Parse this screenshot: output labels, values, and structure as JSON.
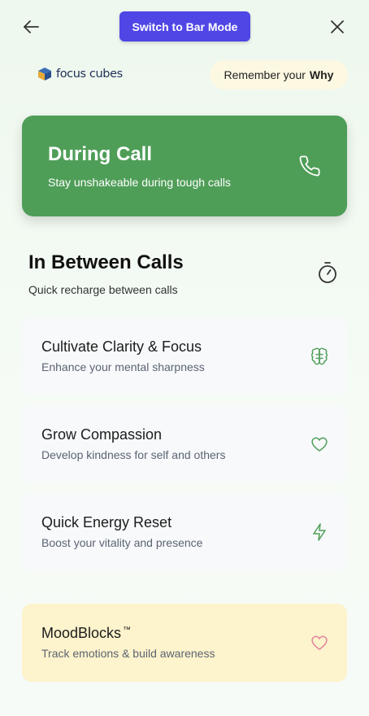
{
  "header": {
    "switch_label": "Switch to Bar Mode"
  },
  "brand": {
    "name": "focus cubes",
    "accent_colors": [
      "#3b6fb6",
      "#e6a935",
      "#2a4f8f"
    ]
  },
  "why_pill": {
    "prefix": "Remember your",
    "emphasis": "Why"
  },
  "during_call": {
    "title": "During Call",
    "subtitle": "Stay unshakeable during tough calls",
    "icon": "phone-icon",
    "color": "#4f9e58"
  },
  "between_calls": {
    "title": "In Between Calls",
    "subtitle": "Quick recharge between calls",
    "icon": "timer-icon"
  },
  "options": [
    {
      "title": "Cultivate Clarity & Focus",
      "subtitle": "Enhance your mental sharpness",
      "icon": "brain-icon"
    },
    {
      "title": "Grow Compassion",
      "subtitle": "Develop kindness for self and others",
      "icon": "heart-icon"
    },
    {
      "title": "Quick Energy Reset",
      "subtitle": "Boost your vitality and presence",
      "icon": "lightning-icon"
    }
  ],
  "moodblocks": {
    "title": "MoodBlocks",
    "trademark": "™",
    "subtitle": "Track emotions & build awareness",
    "icon": "heart-outline-icon",
    "color": "#fdf3cc"
  }
}
